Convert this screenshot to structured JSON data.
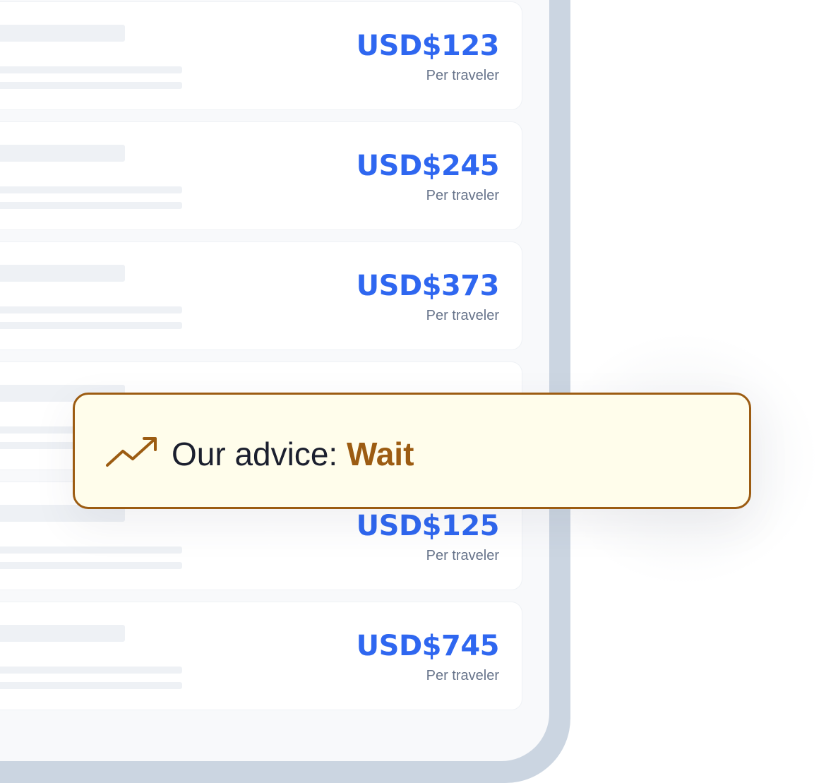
{
  "results": [
    {
      "price": "USD$123",
      "note": "Per traveler"
    },
    {
      "price": "USD$245",
      "note": "Per traveler"
    },
    {
      "price": "USD$373",
      "note": "Per traveler"
    },
    {
      "price": "",
      "note": ""
    },
    {
      "price": "USD$125",
      "note": "Per traveler"
    },
    {
      "price": "USD$745",
      "note": "Per traveler"
    }
  ],
  "advice": {
    "icon": "trending-up-icon",
    "label": "Our advice: ",
    "value": "Wait"
  },
  "colors": {
    "price": "#2f67f0",
    "advice_accent": "#9c5c12",
    "advice_bg": "#fffdeb",
    "frame": "#cbd5e1"
  }
}
